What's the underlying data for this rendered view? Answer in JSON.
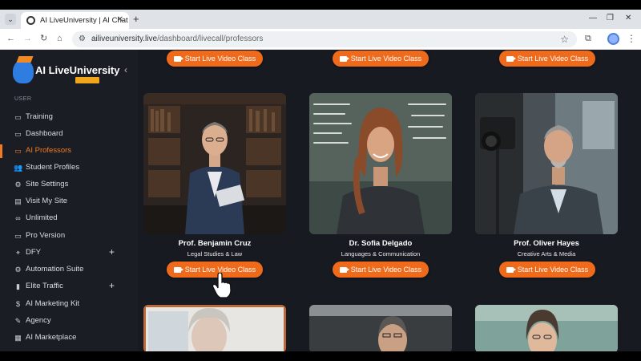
{
  "browser": {
    "tab_title": "AI LiveUniversity | AI Chat",
    "url_host": "ailiveuniversity.live",
    "url_path": "/dashboard/livecall/professors"
  },
  "sidebar": {
    "logo_text": "AI LiveUniversity",
    "section_label": "USER",
    "items": [
      {
        "label": "Training",
        "icon": "monitor-icon"
      },
      {
        "label": "Dashboard",
        "icon": "dashboard-icon"
      },
      {
        "label": "AI Professors",
        "icon": "professor-icon",
        "active": true
      },
      {
        "label": "Student Profiles",
        "icon": "users-icon"
      },
      {
        "label": "Site Settings",
        "icon": "gear-icon"
      },
      {
        "label": "Visit My Site",
        "icon": "browser-icon"
      },
      {
        "label": "Unlimited",
        "icon": "infinity-icon"
      },
      {
        "label": "Pro Version",
        "icon": "window-icon"
      },
      {
        "label": "DFY",
        "icon": "location-icon",
        "expandable": true
      },
      {
        "label": "Automation Suite",
        "icon": "automation-icon"
      },
      {
        "label": "Elite Traffic",
        "icon": "traffic-icon",
        "expandable": true
      },
      {
        "label": "AI Marketing Kit",
        "icon": "dollar-icon"
      },
      {
        "label": "Agency",
        "icon": "agency-icon"
      },
      {
        "label": "AI Marketplace",
        "icon": "marketplace-icon"
      }
    ]
  },
  "main": {
    "button_label": "Start Live Video Class",
    "professors": [
      {
        "name": "Prof. Benjamin Cruz",
        "subject": "Legal Studies & Law"
      },
      {
        "name": "Dr. Sofia Delgado",
        "subject": "Languages & Communication"
      },
      {
        "name": "Prof. Oliver Hayes",
        "subject": "Creative Arts & Media"
      }
    ]
  },
  "colors": {
    "accent": "#ef6b1b",
    "sidebar_bg": "#1a1d24",
    "page_bg": "#171a21"
  }
}
